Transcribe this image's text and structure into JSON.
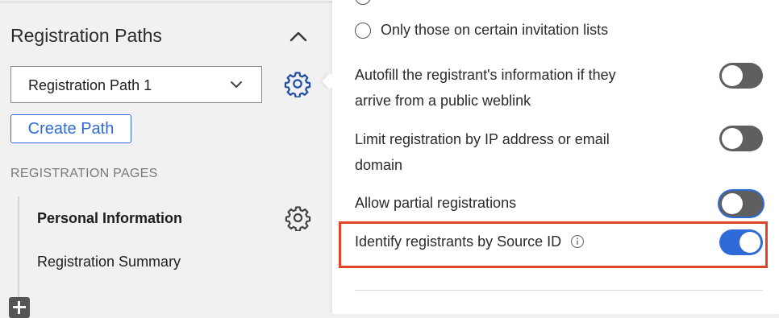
{
  "sidebar": {
    "section_title": "Registration Paths",
    "path_select": {
      "value": "Registration Path 1"
    },
    "create_path_label": "Create Path",
    "pages_heading": "REGISTRATION PAGES",
    "pages": [
      {
        "label": "Personal Information",
        "active": true
      },
      {
        "label": "Registration Summary",
        "active": false
      }
    ]
  },
  "settings": {
    "partial_radio_label": "Only those on certain invitation lists",
    "options": [
      {
        "label_line1": "Autofill the registrant's information if they",
        "label_line2": "arrive from a public weblink",
        "enabled": false
      },
      {
        "label_line1": "Limit registration by IP address or email",
        "label_line2": "domain",
        "enabled": false
      },
      {
        "label_line1": "Allow partial registrations",
        "enabled": false
      },
      {
        "label_line1": "Identify registrants by Source ID",
        "enabled": true
      }
    ]
  },
  "colors": {
    "accent": "#2f6bd8",
    "highlight": "#e0452a",
    "toggle_off": "#5f5f5f"
  },
  "icons": {
    "collapse": "chevron-up-icon",
    "dropdown": "chevron-down-icon",
    "path_settings": "gear-icon",
    "page_settings": "gear-icon",
    "add_page": "plus-icon",
    "info": "info-icon"
  }
}
